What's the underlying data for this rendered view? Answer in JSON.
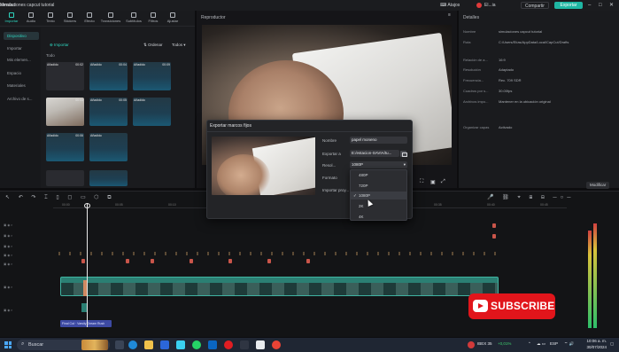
{
  "titlebar": {
    "app_name": "CapCut",
    "menu_label": "Menú",
    "project_title": "simulaciones capcut tutorial",
    "shortcuts_label": "Atajos",
    "user_label": "El...ia",
    "share_label": "Compartir",
    "export_label": "Exportar"
  },
  "toolbar_tabs": [
    {
      "label": "Importar"
    },
    {
      "label": "Audio"
    },
    {
      "label": "Texto"
    },
    {
      "label": "Stickers"
    },
    {
      "label": "Efecto"
    },
    {
      "label": "Transiciones"
    },
    {
      "label": "Subtítulos"
    },
    {
      "label": "Filtros"
    },
    {
      "label": "Ajustar"
    }
  ],
  "media_sidebar": [
    {
      "label": "Dispositivo"
    },
    {
      "label": "Importar"
    },
    {
      "label": "Mis elemen..."
    },
    {
      "label": "Espacio"
    },
    {
      "label": "Materiales"
    },
    {
      "label": "Archivo de s..."
    }
  ],
  "media_toolbar": {
    "import_label": "Importar",
    "sort_label": "Ordenar",
    "all_label": "Todos"
  },
  "media_section": "Todo",
  "media_items": [
    {
      "name": "Añadido",
      "duration": "00:02"
    },
    {
      "name": "Añadido",
      "duration": "00:04"
    },
    {
      "name": "Añadido",
      "duration": "00:09"
    },
    {
      "name": "",
      "duration": "00:04"
    },
    {
      "name": "Añadido",
      "duration": "00:05"
    },
    {
      "name": "Añadido",
      "duration": ""
    },
    {
      "name": "Añadido",
      "duration": "00:06"
    },
    {
      "name": "Añadido",
      "duration": ""
    }
  ],
  "player": {
    "title": "Reproductor"
  },
  "details": {
    "title": "Detalles",
    "rows": [
      {
        "k": "Nombre",
        "v": "simulaciones capcut tutorial"
      },
      {
        "k": "Ruta",
        "v": "C:/Users/Elías/AppData/Local/CapCut/Drafts"
      },
      {
        "k": "Relación de a...",
        "v": "16:9"
      },
      {
        "k": "Resolución",
        "v": "Adaptado"
      },
      {
        "k": "Frecuencia...",
        "v": "Rec. 709 SDR"
      },
      {
        "k": "Cuadros por s...",
        "v": "30.00fps"
      },
      {
        "k": "Archivos impo...",
        "v": "Mantener en la ubicación original"
      },
      {
        "k": "Organizar capas",
        "v": "Activado"
      }
    ],
    "modify_label": "Modificar"
  },
  "modal": {
    "title": "Exportar marcos fijos",
    "name_label": "Nombre",
    "name_value": "papel moneno",
    "export_to_label": "Exportar a",
    "export_to_value": "E:/estacion-SAVIA/tu...",
    "resolution_label": "Resol...",
    "resolution_value": "1080P",
    "format_label": "Formato",
    "import_label": "Importar proy...",
    "options": [
      "480P",
      "720P",
      "1080P",
      "2K",
      "4K"
    ],
    "selected_check": "✓"
  },
  "timeline": {
    "audio_clip_label": "Final Cut · Varsity Dream Rush",
    "ruler_marks": [
      "00:00",
      "00:05",
      "00:10",
      "00:15",
      "00:20",
      "00:25",
      "00:30",
      "00:35",
      "00:40",
      "00:45"
    ]
  },
  "subscribe": {
    "label": "SUBSCRIBE"
  },
  "taskbar": {
    "search_placeholder": "Buscar",
    "stock_name": "IBEX 35",
    "stock_change": "+0,01%",
    "lang": "ESP",
    "time": "10:06 a. m.",
    "date": "30/07/2024"
  },
  "colors": {
    "accent": "#1fb6a3",
    "subscribe": "#e1151b",
    "clip": "#2b7f73"
  }
}
